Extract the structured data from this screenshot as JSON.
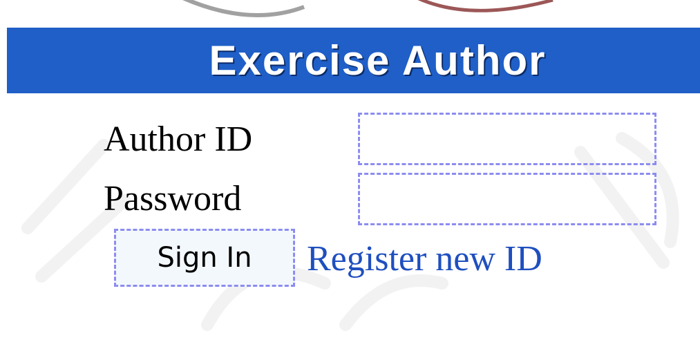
{
  "header": {
    "title": "Exercise Author",
    "background_color": "#1f5fc7",
    "text_color": "#ffffff"
  },
  "form": {
    "author_id_label": "Author ID",
    "author_id_value": "",
    "password_label": "Password",
    "password_value": "",
    "sign_in_label": "Sign In",
    "register_link_label": "Register new ID",
    "link_color": "#1f4fbf",
    "focus_border_color": "#8c8cf0"
  },
  "decor": {
    "logo": "logo-arc",
    "watermark": "diagonal-watermark"
  }
}
